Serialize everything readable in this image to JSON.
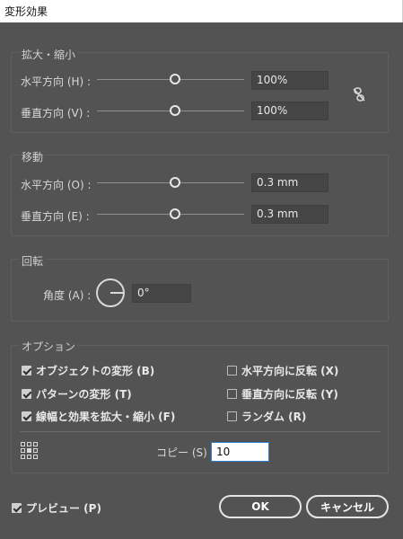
{
  "window": {
    "title": "変形効果"
  },
  "scale": {
    "group_label": "拡大・縮小",
    "horizontal": {
      "label": "水平方向 (H) :",
      "value": "100%",
      "slider_fraction": 0.5
    },
    "vertical": {
      "label": "垂直方向 (V) :",
      "value": "100%",
      "slider_fraction": 0.5
    }
  },
  "move": {
    "group_label": "移動",
    "horizontal": {
      "label": "水平方向 (O) :",
      "value": "0.3 mm",
      "slider_fraction": 0.5
    },
    "vertical": {
      "label": "垂直方向 (E) :",
      "value": "0.3 mm",
      "slider_fraction": 0.5
    }
  },
  "rotate": {
    "group_label": "回転",
    "angle_label": "角度 (A) :",
    "angle_value": "0°"
  },
  "options": {
    "group_label": "オプション",
    "transform_objects": {
      "label": "オブジェクトの変形 (B)",
      "checked": true
    },
    "transform_patterns": {
      "label": "パターンの変形 (T)",
      "checked": true
    },
    "scale_strokes": {
      "label": "線幅と効果を拡大・縮小 (F)",
      "checked": true
    },
    "reflect_x": {
      "label": "水平方向に反転 (X)",
      "checked": false
    },
    "reflect_y": {
      "label": "垂直方向に反転 (Y)",
      "checked": false
    },
    "random": {
      "label": "ランダム (R)",
      "checked": false
    },
    "copies_label": "コピー (S)",
    "copies_value": "10"
  },
  "footer": {
    "preview_label": "プレビュー (P)",
    "preview_checked": true,
    "ok_label": "OK",
    "cancel_label": "キャンセル"
  },
  "icons": {
    "link": "link-broken-icon",
    "angle_dial": "angle-dial-icon",
    "reference_point": "reference-point-icon"
  }
}
